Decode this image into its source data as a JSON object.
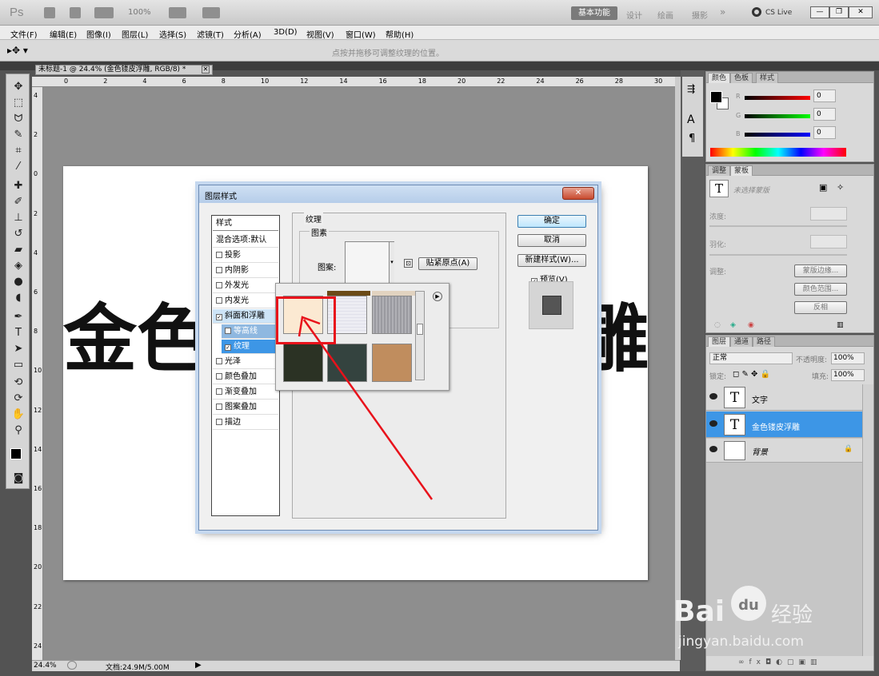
{
  "app": {
    "logo": "Ps",
    "zoom_menu": "100%",
    "workspaces": [
      "基本功能",
      "设计",
      "绘画",
      "摄影"
    ],
    "more": "»",
    "cs_live": "CS Live"
  },
  "menu": [
    "文件(F)",
    "编辑(E)",
    "图像(I)",
    "图层(L)",
    "选择(S)",
    "滤镜(T)",
    "分析(A)",
    "3D(D)",
    "视图(V)",
    "窗口(W)",
    "帮助(H)"
  ],
  "options_hint": "点按并拖移可调整纹理的位置。",
  "document": {
    "tab_title": "未标题-1 @ 24.4% (金色镂皮浮雕, RGB/8) *",
    "close": "✕",
    "canvas_text_left": "金色",
    "canvas_text_right": "雕",
    "ruler_top": [
      "0",
      "2",
      "4",
      "6",
      "8",
      "10",
      "12",
      "14",
      "16",
      "18",
      "20",
      "22",
      "24",
      "26",
      "28",
      "30"
    ],
    "ruler_left": [
      "4",
      "2",
      "0",
      "2",
      "4",
      "6",
      "8",
      "10",
      "12",
      "14",
      "16",
      "18",
      "20",
      "22",
      "24"
    ],
    "zoom": "24.4%",
    "doc_info": "文档:24.9M/5.00M"
  },
  "color_panel": {
    "tabs": [
      "颜色",
      "色板",
      "样式"
    ],
    "r_label": "R",
    "g_label": "G",
    "b_label": "B",
    "r": "0",
    "g": "0",
    "b": "0"
  },
  "adjust_panel": {
    "tabs": [
      "调整",
      "蒙板"
    ],
    "no_selection": "未选择蒙版",
    "density": "浓度:",
    "feather": "羽化:",
    "adjust": "调整:",
    "mask_edge": "蒙版边缘...",
    "color_range": "颜色范围...",
    "invert": "反相"
  },
  "layers_panel": {
    "tabs": [
      "图层",
      "通道",
      "路径"
    ],
    "blend_mode": "正常",
    "opacity_label": "不透明度:",
    "opacity": "100%",
    "lock_label": "锁定:",
    "fill_label": "填充:",
    "fill": "100%",
    "layers": [
      {
        "name": "文字",
        "thumb": "T"
      },
      {
        "name": "金色镂皮浮雕",
        "thumb": "T"
      },
      {
        "name": "背景",
        "thumb": ""
      }
    ]
  },
  "dialog": {
    "title": "图层样式",
    "close": "✕",
    "styles_header": "样式",
    "blend_options": "混合选项:默认",
    "styles": [
      {
        "label": "投影",
        "checked": false
      },
      {
        "label": "内阴影",
        "checked": false
      },
      {
        "label": "外发光",
        "checked": false
      },
      {
        "label": "内发光",
        "checked": false
      },
      {
        "label": "斜面和浮雕",
        "checked": true
      },
      {
        "label": "等高线",
        "checked": false
      },
      {
        "label": "纹理",
        "checked": true
      },
      {
        "label": "光泽",
        "checked": false
      },
      {
        "label": "颜色叠加",
        "checked": false
      },
      {
        "label": "渐变叠加",
        "checked": false
      },
      {
        "label": "图案叠加",
        "checked": false
      },
      {
        "label": "描边",
        "checked": false
      }
    ],
    "section_title": "纹理",
    "group_title": "图素",
    "pattern_label": "图案:",
    "snap_origin": "贴紧原点(A)",
    "ok": "确定",
    "cancel": "取消",
    "new_style": "新建样式(W)...",
    "preview_label": "预览(V)",
    "preview_checked": true
  },
  "patterns": [
    "#fbe9d2",
    "#ededf3",
    "#a7a7ac",
    "#2b3224",
    "#34433f",
    "#c08d5e"
  ],
  "watermark": {
    "logo": "Bai",
    "logo2": "du",
    "cn": "经验",
    "url": "jingyan.baidu.com"
  }
}
